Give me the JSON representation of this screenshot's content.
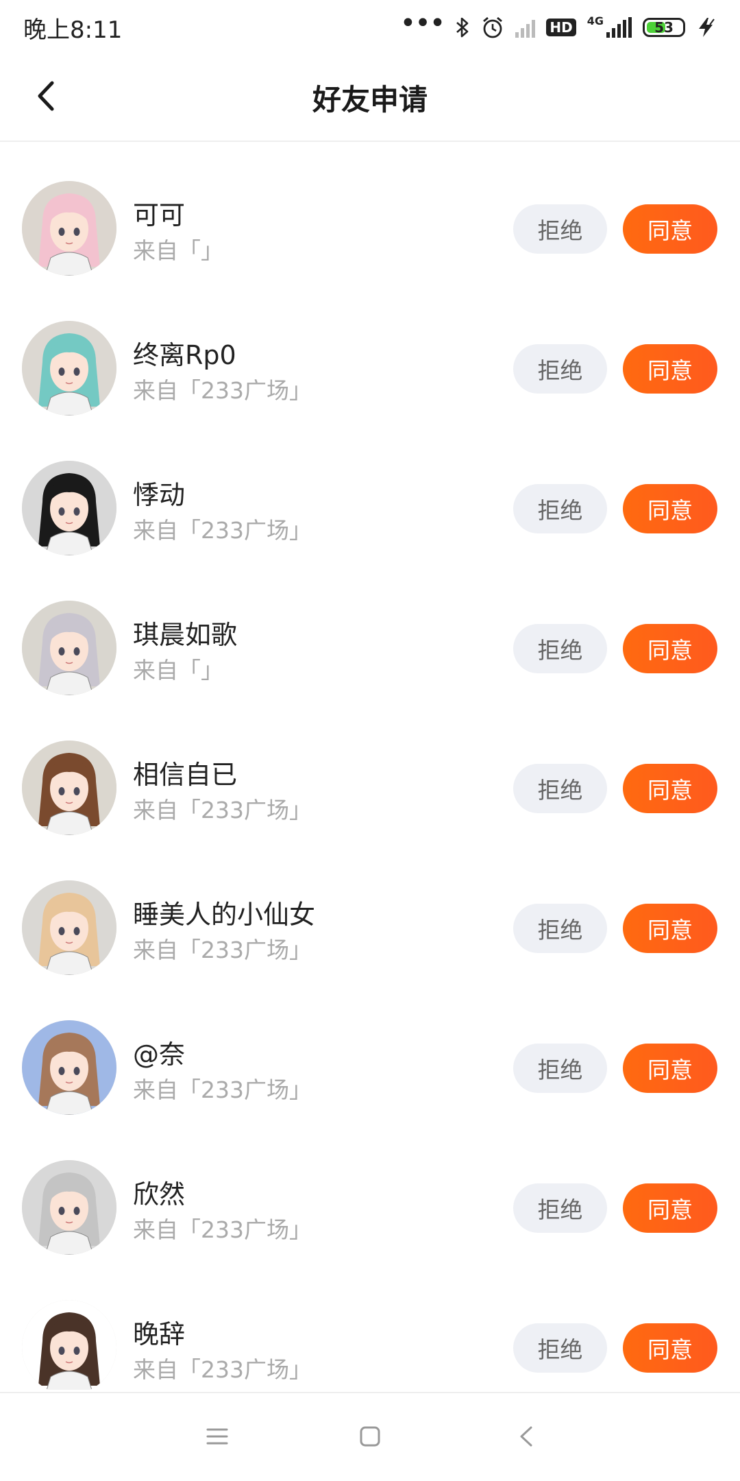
{
  "status_bar": {
    "time": "晚上8:11",
    "network": "4G",
    "hd": "HD",
    "battery": "53",
    "battery_level": 0.53,
    "icons": [
      "more-dots-icon",
      "bluetooth-icon",
      "alarm-icon",
      "signal-muted-icon",
      "hd-icon",
      "signal-4g-icon",
      "battery-icon",
      "charging-icon"
    ]
  },
  "header": {
    "title": "好友申请",
    "back_icon": "chevron-left-icon"
  },
  "colors": {
    "accept": "#ff6110",
    "reject_bg": "#eef0f5",
    "source_text": "#aaaaaa"
  },
  "requests": [
    {
      "name": "可可",
      "source": "来自「」",
      "reject": "拒绝",
      "accept": "同意",
      "avatar_bg": "#dcd6cf",
      "hair": "#f3c2cf"
    },
    {
      "name": "终离Rp0",
      "source": "来自「233广场」",
      "reject": "拒绝",
      "accept": "同意",
      "avatar_bg": "#dcd8d2",
      "hair": "#74c9c3"
    },
    {
      "name": "悸动",
      "source": "来自「233广场」",
      "reject": "拒绝",
      "accept": "同意",
      "avatar_bg": "#d8d8d8",
      "hair": "#1a1a1a"
    },
    {
      "name": "琪晨如歌",
      "source": "来自「」",
      "reject": "拒绝",
      "accept": "同意",
      "avatar_bg": "#d9d6cf",
      "hair": "#c9c5cf"
    },
    {
      "name": "相信自已",
      "source": "来自「233广场」",
      "reject": "拒绝",
      "accept": "同意",
      "avatar_bg": "#dbd7cf",
      "hair": "#7a4a2e"
    },
    {
      "name": "睡美人的小仙女",
      "source": "来自「233广场」",
      "reject": "拒绝",
      "accept": "同意",
      "avatar_bg": "#dad8d4",
      "hair": "#e8c59a"
    },
    {
      "name": "@奈",
      "source": "来自「233广场」",
      "reject": "拒绝",
      "accept": "同意",
      "avatar_bg": "#9fb8e6",
      "hair": "#a6785a"
    },
    {
      "name": "欣然",
      "source": "来自「233广场」",
      "reject": "拒绝",
      "accept": "同意",
      "avatar_bg": "#d8d8d8",
      "hair": "#c4c4c4"
    },
    {
      "name": "晚辞",
      "source": "来自「233广场」",
      "reject": "拒绝",
      "accept": "同意",
      "avatar_bg": "#ffffff",
      "hair": "#4a3328"
    }
  ],
  "system_nav": {
    "icons": [
      "menu-icon",
      "home-square-icon",
      "back-triangle-icon"
    ]
  }
}
